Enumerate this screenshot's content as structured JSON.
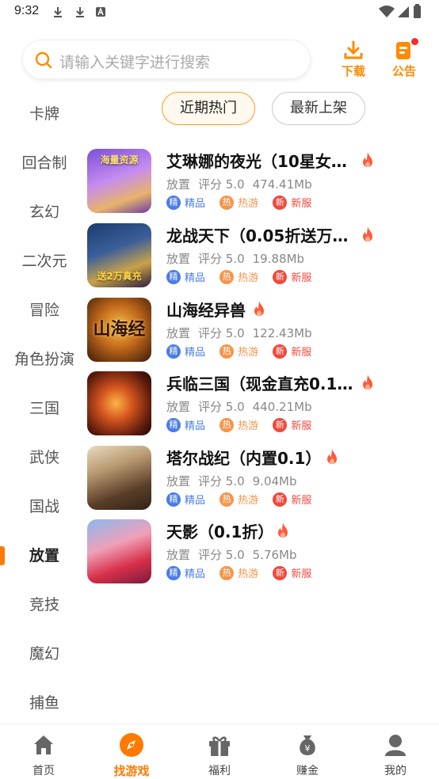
{
  "status_bar": {
    "time": "9:32"
  },
  "search": {
    "placeholder": "请输入关键字进行搜索"
  },
  "header": {
    "download_label": "下载",
    "notice_label": "公告",
    "accent": "#ff8a00"
  },
  "sidebar": {
    "items": [
      {
        "label": "卡牌"
      },
      {
        "label": "回合制"
      },
      {
        "label": "玄幻"
      },
      {
        "label": "二次元"
      },
      {
        "label": "冒险"
      },
      {
        "label": "角色扮演"
      },
      {
        "label": "三国"
      },
      {
        "label": "武侠"
      },
      {
        "label": "国战"
      },
      {
        "label": "放置",
        "active": true
      },
      {
        "label": "竞技"
      },
      {
        "label": "魔幻"
      },
      {
        "label": "捕鱼"
      }
    ]
  },
  "tabs": {
    "hot": "近期热门",
    "new": "最新上架"
  },
  "tag_labels": {
    "jing_badge": "精",
    "jing": "精品",
    "re_badge": "热",
    "re": "热游",
    "xin_badge": "新",
    "xin": "新服"
  },
  "games": [
    {
      "title": "艾琳娜的夜光（10星女…",
      "category": "放置",
      "rating": "评分 5.0",
      "size": "474.41Mb",
      "thumb_text": "海量资源"
    },
    {
      "title": "龙战天下（0.05折送万…",
      "category": "放置",
      "rating": "评分 5.0",
      "size": "19.88Mb",
      "thumb_text": "送2万真充"
    },
    {
      "title": "山海经异兽",
      "category": "放置",
      "rating": "评分 5.0",
      "size": "122.43Mb",
      "thumb_text": "山海经"
    },
    {
      "title": "兵临三国（现金直充0.1…",
      "category": "放置",
      "rating": "评分 5.0",
      "size": "440.21Mb",
      "thumb_text": ""
    },
    {
      "title": "塔尔战纪（内置0.1）",
      "category": "放置",
      "rating": "评分 5.0",
      "size": "9.04Mb",
      "thumb_text": ""
    },
    {
      "title": "天影（0.1折）",
      "category": "放置",
      "rating": "评分 5.0",
      "size": "5.76Mb",
      "thumb_text": ""
    }
  ],
  "bottom_nav": [
    {
      "label": "首页"
    },
    {
      "label": "找游戏",
      "active": true
    },
    {
      "label": "福利"
    },
    {
      "label": "赚金"
    },
    {
      "label": "我的"
    }
  ]
}
